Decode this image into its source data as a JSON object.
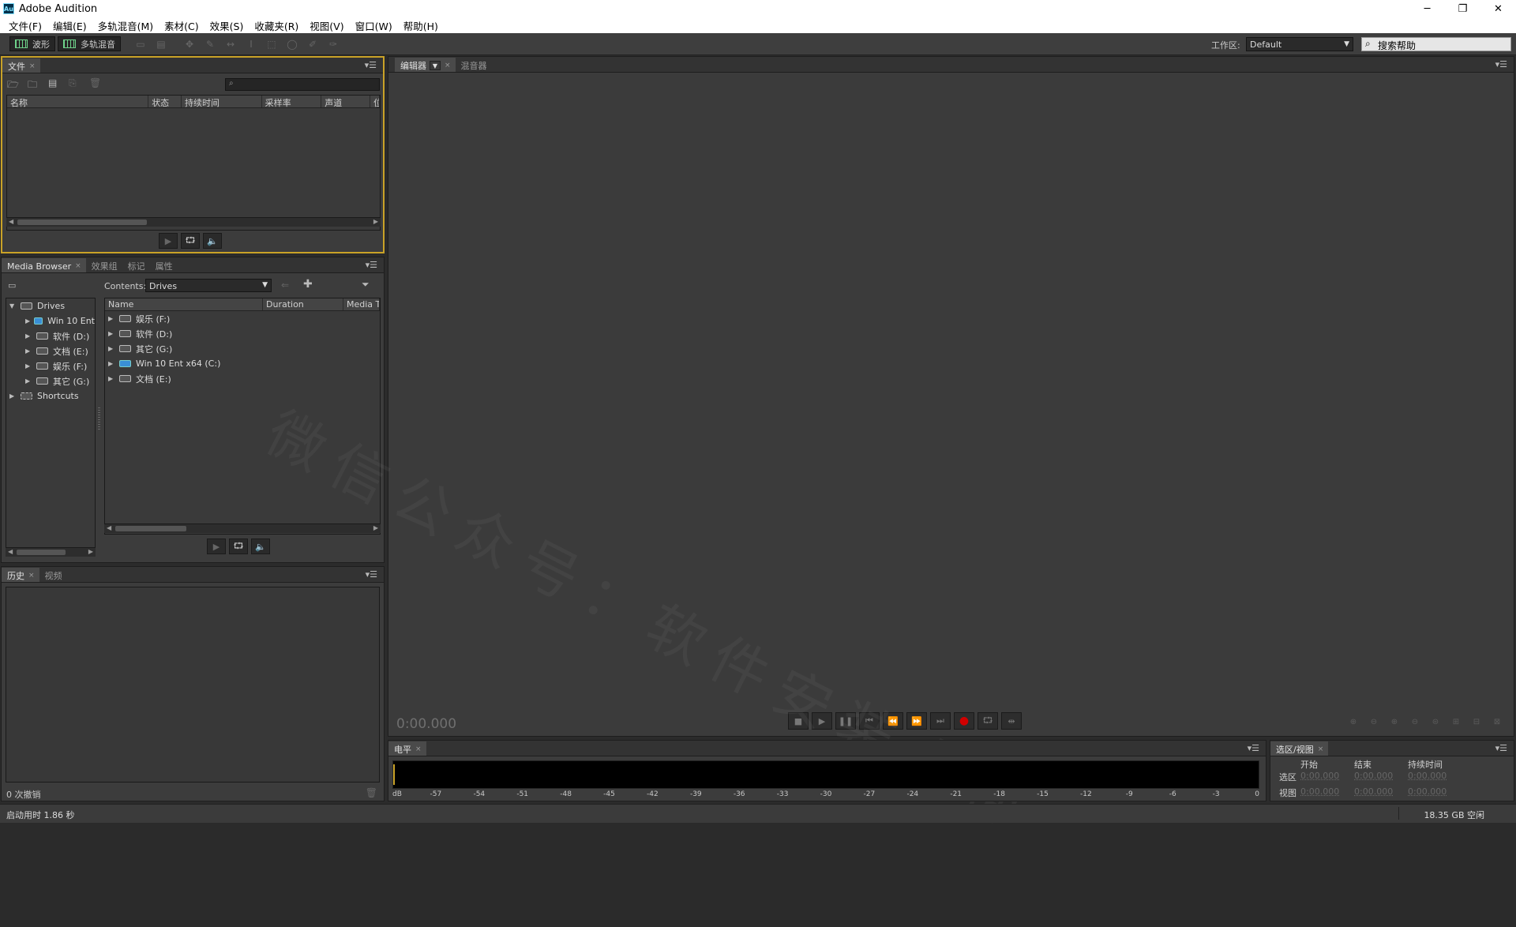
{
  "app": {
    "title": "Adobe Audition",
    "logo_text": "Au"
  },
  "window_controls": {
    "minimize": "─",
    "restore": "❐",
    "close": "✕"
  },
  "menu": [
    "文件(F)",
    "编辑(E)",
    "多轨混音(M)",
    "素材(C)",
    "效果(S)",
    "收藏夹(R)",
    "视图(V)",
    "窗口(W)",
    "帮助(H)"
  ],
  "toolbar": {
    "waveform_label": "波形",
    "multitrack_label": "多轨混音",
    "workspace_label": "工作区:",
    "workspace_value": "Default",
    "help_search_placeholder": "搜索帮助"
  },
  "files_panel": {
    "tab": "文件",
    "columns": [
      "名称",
      "状态",
      "持续时间",
      "采样率",
      "声道",
      "位"
    ]
  },
  "media_browser": {
    "tabs": [
      "Media Browser",
      "效果组",
      "标记",
      "属性"
    ],
    "contents_label": "Contents:",
    "contents_value": "Drives",
    "tree": [
      {
        "label": "Drives",
        "level": 0,
        "expanded": true
      },
      {
        "label": "Win 10 Ent",
        "level": 1,
        "win": true
      },
      {
        "label": "软件 (D:)",
        "level": 1
      },
      {
        "label": "文档 (E:)",
        "level": 1
      },
      {
        "label": "娱乐 (F:)",
        "level": 1
      },
      {
        "label": "其它 (G:)",
        "level": 1
      },
      {
        "label": "Shortcuts",
        "level": 0,
        "expanded": false
      }
    ],
    "columns": [
      "Name",
      "Duration",
      "Media Ty"
    ],
    "items": [
      {
        "label": "娱乐 (F:)"
      },
      {
        "label": "软件 (D:)"
      },
      {
        "label": "其它 (G:)"
      },
      {
        "label": "Win 10 Ent x64 (C:)",
        "win": true
      },
      {
        "label": "文档 (E:)"
      }
    ]
  },
  "history_panel": {
    "tabs": [
      "历史",
      "视频"
    ],
    "status": "0 次撤销"
  },
  "editor": {
    "tabs": [
      "编辑器",
      "混音器"
    ],
    "timecode": "0:00.000"
  },
  "levels": {
    "tab": "电平",
    "scale": [
      "dB",
      "-57",
      "-54",
      "-51",
      "-48",
      "-45",
      "-42",
      "-39",
      "-36",
      "-33",
      "-30",
      "-27",
      "-24",
      "-21",
      "-18",
      "-15",
      "-12",
      "-9",
      "-6",
      "-3",
      "0"
    ]
  },
  "selection_view": {
    "tab": "选区/视图",
    "headers": [
      "开始",
      "结束",
      "持续时间"
    ],
    "rows": [
      {
        "label": "选区",
        "start": "0:00.000",
        "end": "0:00.000",
        "duration": "0:00.000"
      },
      {
        "label": "视图",
        "start": "0:00.000",
        "end": "0:00.000",
        "duration": "0:00.000"
      }
    ]
  },
  "statusbar": {
    "launch_time": "启动用时 1.86 秒",
    "disk_free": "18.35 GB 空闲"
  },
  "watermark": "微信公众号：软件安装大神",
  "colors": {
    "accent_focus": "#c9a227",
    "record": "#d10000",
    "panel_bg": "#3c3c3c"
  }
}
